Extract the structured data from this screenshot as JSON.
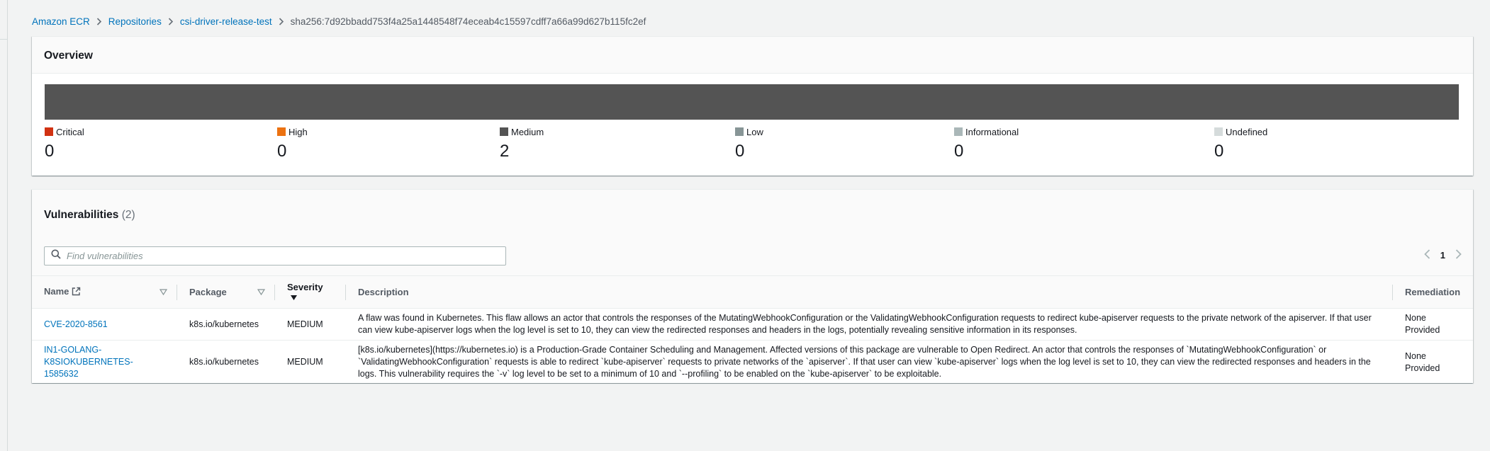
{
  "breadcrumb": {
    "items": [
      "Amazon ECR",
      "Repositories",
      "csi-driver-release-test"
    ],
    "current": "sha256:7d92bbadd753f4a25a1448548f74eceab4c15597cdff7a66a99d627b115fc2ef"
  },
  "overview": {
    "title": "Overview",
    "severities": [
      {
        "label": "Critical",
        "count": "0",
        "color": "#d13212"
      },
      {
        "label": "High",
        "count": "0",
        "color": "#ec7211"
      },
      {
        "label": "Medium",
        "count": "2",
        "color": "#545454"
      },
      {
        "label": "Low",
        "count": "0",
        "color": "#879596"
      },
      {
        "label": "Informational",
        "count": "0",
        "color": "#aab7b8"
      },
      {
        "label": "Undefined",
        "count": "0",
        "color": "#d5dbdb"
      }
    ]
  },
  "vulnerabilities": {
    "title": "Vulnerabilities",
    "count": "(2)",
    "search_placeholder": "Find vulnerabilities",
    "page": "1",
    "columns": {
      "name": "Name",
      "package": "Package",
      "severity": "Severity",
      "description": "Description",
      "remediation": "Remediation"
    },
    "rows": [
      {
        "name": "CVE-2020-8561",
        "package": "k8s.io/kubernetes",
        "severity": "MEDIUM",
        "description": "A flaw was found in Kubernetes. This flaw allows an actor that controls the responses of the MutatingWebhookConfiguration or the ValidatingWebhookConfiguration requests to redirect kube-apiserver requests to the private network of the apiserver. If that user can view kube-apiserver logs when the log level is set to 10, they can view the redirected responses and headers in the logs, potentially revealing sensitive information in its responses.",
        "remediation": "None Provided"
      },
      {
        "name": "IN1-GOLANG-K8SIOKUBERNETES-1585632",
        "package": "k8s.io/kubernetes",
        "severity": "MEDIUM",
        "description": "[k8s.io/kubernetes](https://kubernetes.io) is a Production-Grade Container Scheduling and Management. Affected versions of this package are vulnerable to Open Redirect. An actor that controls the responses of `MutatingWebhookConfiguration` or `ValidatingWebhookConfiguration` requests is able to redirect `kube-apiserver` requests to private networks of the `apiserver`. If that user can view `kube-apiserver` logs when the log level is set to 10, they can view the redirected responses and headers in the logs.  This vulnerability requires the `-v` log level to be set to a minimum of 10 and `--profiling` to be enabled on the `kube-apiserver` to be exploitable.",
        "remediation": "None Provided"
      }
    ]
  }
}
